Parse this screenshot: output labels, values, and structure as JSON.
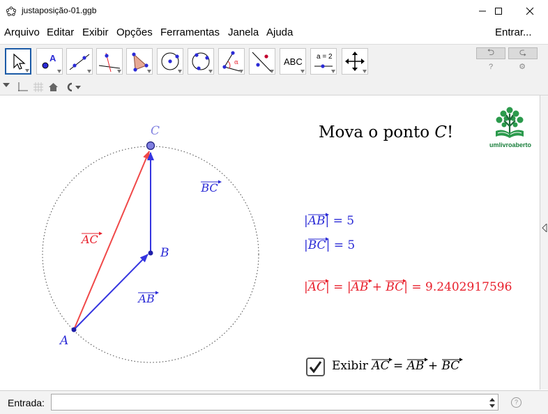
{
  "window": {
    "title": "justaposição-01.ggb",
    "minimize_icon": "minimize-icon",
    "maximize_icon": "maximize-icon",
    "close_icon": "close-icon"
  },
  "menu": [
    "Arquivo",
    "Editar",
    "Exibir",
    "Opções",
    "Ferramentas",
    "Janela",
    "Ajuda"
  ],
  "menu_right": "Entrar...",
  "tools": [
    "move-tool",
    "point-tool",
    "line-tool",
    "perpendicular-line-tool",
    "polygon-tool",
    "circle-center-point-tool",
    "circle-three-points-tool",
    "angle-tool",
    "reflect-tool",
    "text-tool",
    "slider-tool",
    "move-graphics-view-tool"
  ],
  "tool_text": {
    "text_tool": "ABC",
    "slider_tool": "a = 2"
  },
  "graphics": {
    "heading_prefix": "Mova o ponto ",
    "heading_point": "C",
    "heading_suffix": "!",
    "logo_text_a": "um",
    "logo_text_b": "livro",
    "logo_text_c": "aberto",
    "point_labels": {
      "A": "A",
      "B": "B",
      "C": "C"
    },
    "vector_labels": {
      "AC": "AC",
      "AB": "AB",
      "BC": "BC"
    },
    "eq_ab": {
      "vec": "AB",
      "rhs": "= 5"
    },
    "eq_bc": {
      "vec": "BC",
      "rhs": "= 5"
    },
    "eq_sum": {
      "vec1": "AC",
      "mid": "= |",
      "vec2": "AB",
      "plus": "+",
      "vec3": "BC",
      "rhs": "| = 9.2402917596"
    },
    "checkbox": {
      "checked": true,
      "prefix": "Exibir ",
      "v1": "AC",
      "eq": "=",
      "v2": "AB",
      "plus": "+",
      "v3": "BC"
    },
    "colors": {
      "blue": "#2b2bd6",
      "red": "#e8202c",
      "point_c": "#7f7fe0"
    }
  },
  "input_bar": {
    "label": "Entrada:",
    "value": "",
    "help_icon": "help-icon"
  }
}
